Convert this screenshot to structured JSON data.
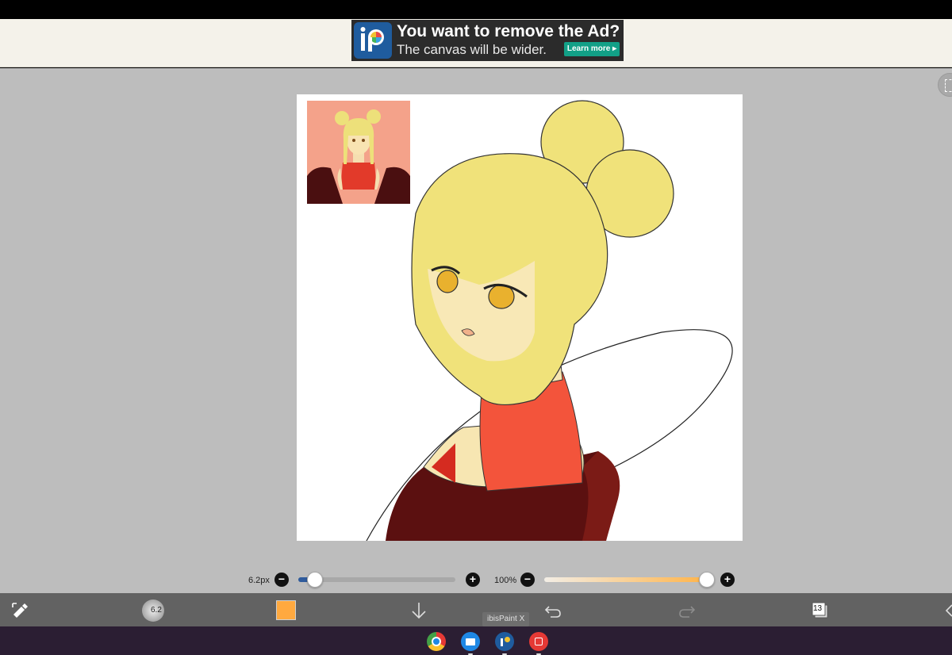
{
  "ad": {
    "title": "You want to remove the Ad?",
    "subtitle": "The canvas will be wider.",
    "button": "Learn more ▸"
  },
  "brush": {
    "size_label": "6.2px",
    "size_value": 6.2,
    "size_fraction": 0.1,
    "thumb_label": "6.2"
  },
  "opacity": {
    "label": "100%",
    "fraction": 1.0
  },
  "colors": {
    "primary_color": "#FFA93F",
    "workspace": "#BDBDBD",
    "toolbar": "#626262",
    "taskbar": "#2B1E33"
  },
  "toolbar": {
    "icons": [
      "transform-icon",
      "brush-icon",
      "color-swatch",
      "down-arrow-icon",
      "undo-icon",
      "redo-icon",
      "layers-icon",
      "back-icon"
    ],
    "layers_count": "13"
  },
  "taskbar": {
    "tooltip": "ibisPaint X",
    "apps": [
      "chrome-icon",
      "files-icon",
      "ibispaint-icon",
      "screen-recorder-icon"
    ]
  }
}
